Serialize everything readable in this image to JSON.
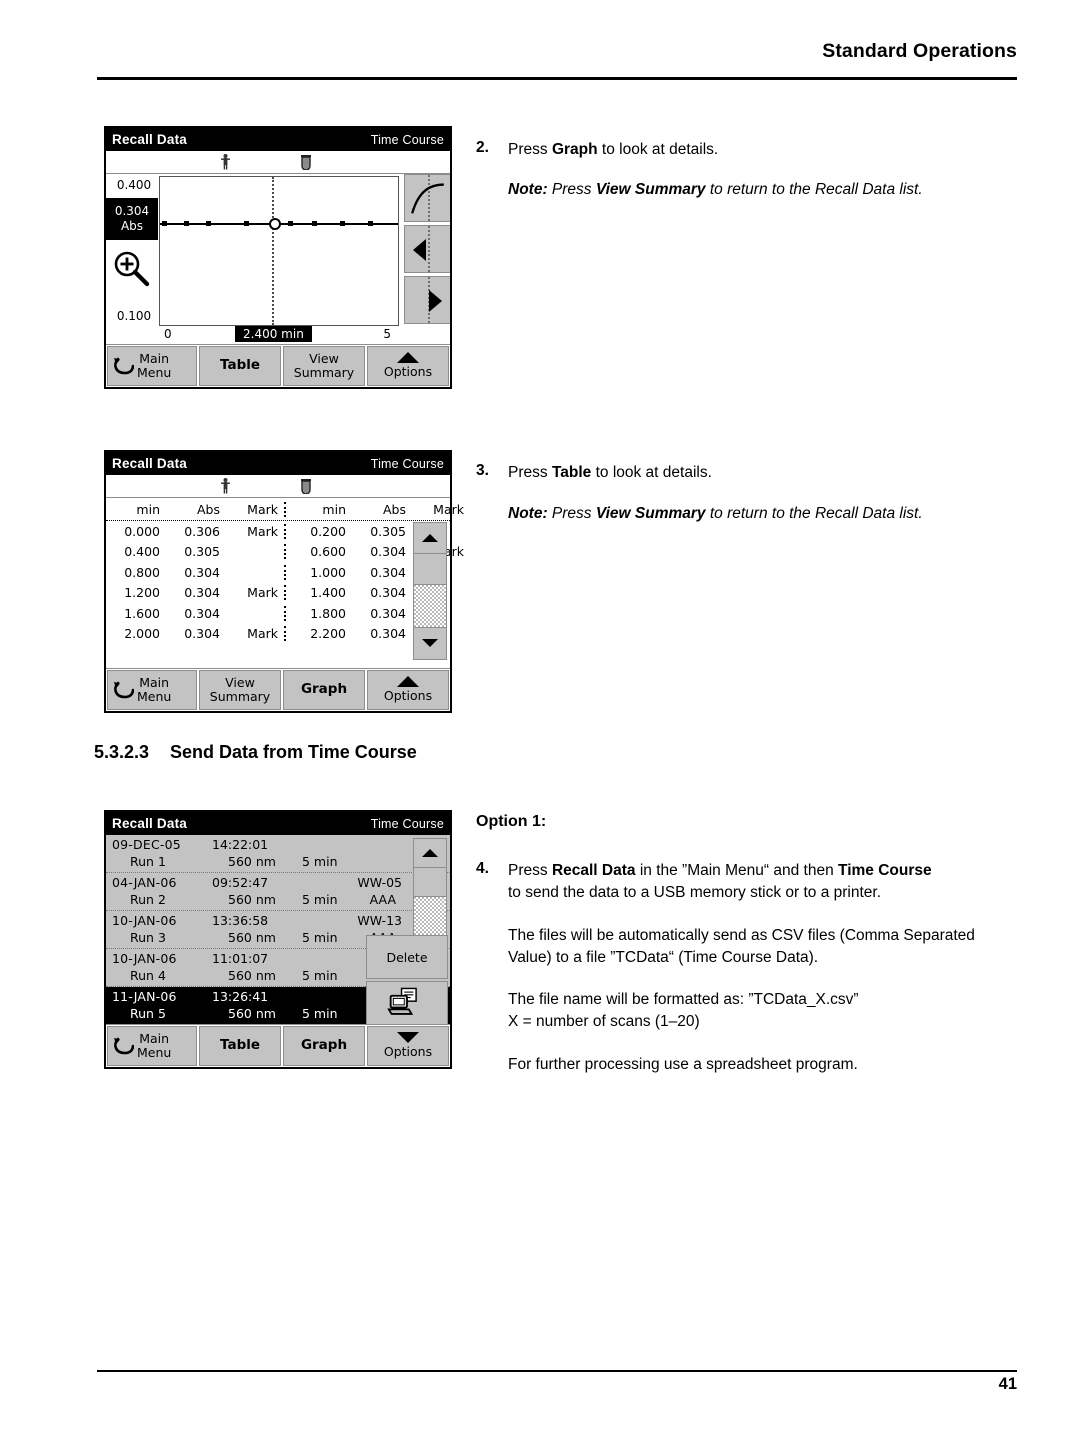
{
  "page": {
    "header_title": "Standard Operations",
    "page_number": "41"
  },
  "section": {
    "number": "5.3.2.3",
    "title": "Send Data from Time Course"
  },
  "steps": {
    "step2": {
      "num": "2.",
      "text_pre": "Press ",
      "bold": "Graph",
      "text_post": " to look at details.",
      "note_label": "Note:",
      "note_pre": " Press ",
      "note_bold": "View Summary",
      "note_post": " to return to the Recall Data list."
    },
    "step3": {
      "num": "3.",
      "text_pre": "Press ",
      "bold": "Table",
      "text_post": " to look at details.",
      "note_label": "Note:",
      "note_pre": " Press ",
      "note_bold": "View Summary",
      "note_post": " to return to the Recall Data list."
    },
    "step4": {
      "option_label": "Option 1:",
      "num": "4.",
      "line1_pre": "Press ",
      "line1_b1": "Recall Data",
      "line1_mid": " in the ”Main Menu“ and then ",
      "line1_b2": "Time Course",
      "line2": "to send the data to a USB memory stick or to a printer.",
      "para1": "The files will be automatically send as CSV files (Comma Separated Value) to a file ”TCData“ (Time Course Data).",
      "para2_line1": "The file name will be formatted as: ”TCData_X.csv”",
      "para2_line2": "X = number of scans (1–20)",
      "para3": "For further processing use a spreadsheet program."
    }
  },
  "screen_graph": {
    "title": "Recall Data",
    "mode": "Time Course",
    "icons": {
      "sample": "person-icon",
      "cuvette": "cuvette-icon"
    },
    "y_max_label": "0.400",
    "y_min_label": "0.100",
    "cursor_value": "0.304",
    "cursor_unit": "Abs",
    "x_min_label": "0",
    "x_max_label": "5",
    "x_cursor_label": "2.400 min",
    "zoom_icon": "zoom-in-magnifier-icon",
    "side_buttons": [
      {
        "name": "curve-view-button",
        "icon": "curve-icon"
      },
      {
        "name": "cursor-left-button",
        "icon": "arrow-left-icon"
      },
      {
        "name": "cursor-right-button",
        "icon": "arrow-right-icon"
      }
    ],
    "softkeys": [
      {
        "label_line1": "Main",
        "label_line2": "Menu",
        "bold": false,
        "icon": "back-arrow-icon"
      },
      {
        "label_line1": "Table",
        "label_line2": "",
        "bold": true,
        "icon": ""
      },
      {
        "label_line1": "View",
        "label_line2": "Summary",
        "bold": false,
        "icon": ""
      },
      {
        "label_line1": "",
        "label_line2": "Options",
        "bold": false,
        "icon": "triangle-up-icon"
      }
    ]
  },
  "chart_data": {
    "type": "line",
    "title": "Recall Data — Time Course",
    "xlabel": "min",
    "ylabel": "Abs",
    "xlim": [
      0,
      5
    ],
    "ylim": [
      0.1,
      0.4
    ],
    "grid": false,
    "cursor": {
      "x": 2.4,
      "y": 0.304,
      "x_label": "2.400 min",
      "y_label": "0.304 Abs"
    },
    "x": [
      0.0,
      0.4,
      0.8,
      1.2,
      1.6,
      2.0,
      2.4,
      2.8,
      3.2,
      3.6,
      4.0,
      4.4
    ],
    "y": [
      0.306,
      0.305,
      0.304,
      0.304,
      0.304,
      0.304,
      0.304,
      0.304,
      0.304,
      0.304,
      0.304,
      0.304
    ]
  },
  "screen_table": {
    "title": "Recall Data",
    "mode": "Time Course",
    "columns": [
      "min",
      "Abs",
      "Mark"
    ],
    "rows_left": [
      {
        "min": "0.000",
        "abs": "0.306",
        "mark": "Mark"
      },
      {
        "min": "0.400",
        "abs": "0.305",
        "mark": ""
      },
      {
        "min": "0.800",
        "abs": "0.304",
        "mark": ""
      },
      {
        "min": "1.200",
        "abs": "0.304",
        "mark": "Mark"
      },
      {
        "min": "1.600",
        "abs": "0.304",
        "mark": ""
      },
      {
        "min": "2.000",
        "abs": "0.304",
        "mark": "Mark"
      }
    ],
    "rows_right": [
      {
        "min": "0.200",
        "abs": "0.305",
        "mark": ""
      },
      {
        "min": "0.600",
        "abs": "0.304",
        "mark": "Mark"
      },
      {
        "min": "1.000",
        "abs": "0.304",
        "mark": ""
      },
      {
        "min": "1.400",
        "abs": "0.304",
        "mark": ""
      },
      {
        "min": "1.800",
        "abs": "0.304",
        "mark": ""
      },
      {
        "min": "2.200",
        "abs": "0.304",
        "mark": ""
      }
    ],
    "softkeys": [
      {
        "label_line1": "Main",
        "label_line2": "Menu",
        "bold": false,
        "icon": "back-arrow-icon"
      },
      {
        "label_line1": "View",
        "label_line2": "Summary",
        "bold": false,
        "icon": ""
      },
      {
        "label_line1": "Graph",
        "label_line2": "",
        "bold": true,
        "icon": ""
      },
      {
        "label_line1": "",
        "label_line2": "Options",
        "bold": false,
        "icon": "triangle-up-icon"
      }
    ]
  },
  "screen_list": {
    "title": "Recall Data",
    "mode": "Time Course",
    "rows": [
      {
        "date": "09-DEC-05",
        "time": "14:22:01",
        "run": "Run 1",
        "wavelength": "560 nm",
        "duration": "5 min",
        "id1": "",
        "id2": "",
        "selected": false
      },
      {
        "date": "04-JAN-06",
        "time": "09:52:47",
        "run": "Run 2",
        "wavelength": "560 nm",
        "duration": "5 min",
        "id1": "WW-05",
        "id2": "AAA",
        "selected": false
      },
      {
        "date": "10-JAN-06",
        "time": "13:36:58",
        "run": "Run 3",
        "wavelength": "560 nm",
        "duration": "5 min",
        "id1": "WW-13",
        "id2": "AAA",
        "selected": false
      },
      {
        "date": "10-JAN-06",
        "time": "11:01:07",
        "run": "Run 4",
        "wavelength": "560 nm",
        "duration": "5 min",
        "id1": "",
        "id2": "",
        "selected": false
      },
      {
        "date": "11-JAN-06",
        "time": "13:26:41",
        "run": "Run 5",
        "wavelength": "560 nm",
        "duration": "5 min",
        "id1": "",
        "id2": "",
        "selected": true
      }
    ],
    "delete_label": "Delete",
    "send_icon": "send-to-computer-icon",
    "softkeys": [
      {
        "label_line1": "Main",
        "label_line2": "Menu",
        "bold": false,
        "icon": "back-arrow-icon"
      },
      {
        "label_line1": "Table",
        "label_line2": "",
        "bold": true,
        "icon": ""
      },
      {
        "label_line1": "Graph",
        "label_line2": "",
        "bold": true,
        "icon": ""
      },
      {
        "label_line1": "",
        "label_line2": "Options",
        "bold": false,
        "icon": "triangle-down-icon"
      }
    ]
  }
}
